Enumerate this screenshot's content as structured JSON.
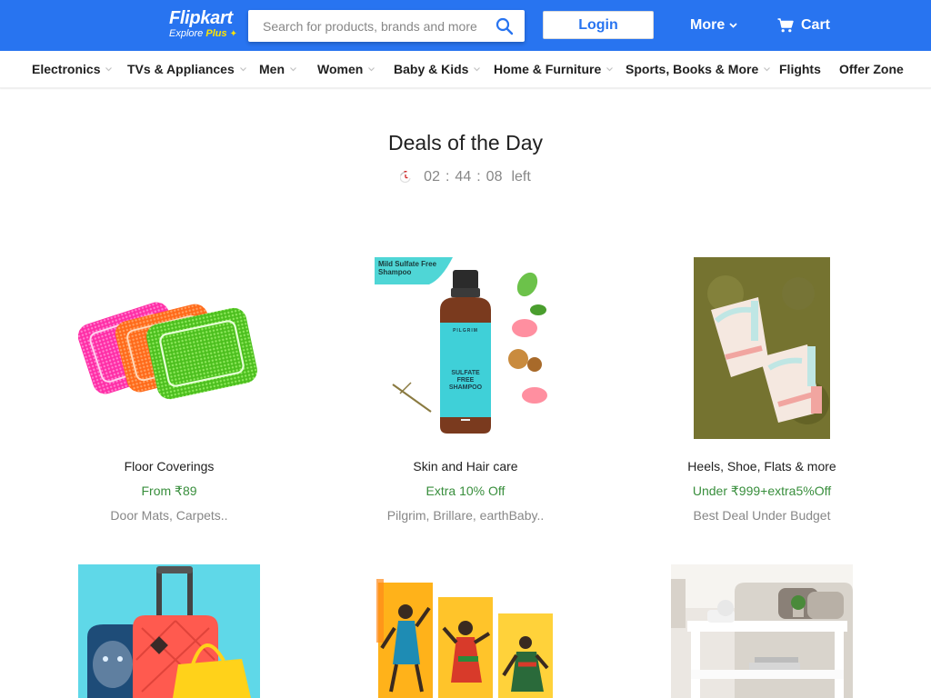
{
  "header": {
    "logo_text": "Flipkart",
    "logo_sub": "Explore",
    "logo_plus": "Plus",
    "search_placeholder": "Search for products, brands and more",
    "login_label": "Login",
    "more_label": "More",
    "cart_label": "Cart",
    "brand_color": "#2874f0"
  },
  "nav": {
    "items": [
      {
        "label": "Electronics",
        "has_caret": true
      },
      {
        "label": "TVs & Appliances",
        "has_caret": true
      },
      {
        "label": "Men",
        "has_caret": true
      },
      {
        "label": "Women",
        "has_caret": true
      },
      {
        "label": "Baby & Kids",
        "has_caret": true
      },
      {
        "label": "Home & Furniture",
        "has_caret": true
      },
      {
        "label": "Sports, Books & More",
        "has_caret": true
      },
      {
        "label": "Flights",
        "has_caret": false
      },
      {
        "label": "Offer Zone",
        "has_caret": false
      }
    ]
  },
  "deals": {
    "title": "Deals of the Day",
    "timer_hours": "02",
    "timer_minutes": "44",
    "timer_seconds": "08",
    "timer_suffix": "left",
    "separator": ":"
  },
  "products": [
    {
      "name": "Floor Coverings",
      "offer": "From ₹89",
      "sub": "Door Mats, Carpets..",
      "image": "floor-mats-image"
    },
    {
      "name": "Skin and Hair care",
      "offer": "Extra 10% Off",
      "sub": "Pilgrim, Brillare, earthBaby..",
      "image": "shampoo-bottle-image",
      "badge": "Mild Sulfate Free Shampoo",
      "bottle_brand": "PILGRIM",
      "bottle_label": "SULFATE FREE SHAMPOO"
    },
    {
      "name": "Heels, Shoe, Flats & more",
      "offer": "Under ₹999+extra5%Off",
      "sub": "Best Deal Under Budget",
      "image": "heel-sandals-image"
    },
    {
      "name": "",
      "offer": "",
      "sub": "",
      "image": "luggage-bags-image"
    },
    {
      "name": "",
      "offer": "",
      "sub": "",
      "image": "tribal-art-paintings-image"
    },
    {
      "name": "",
      "offer": "",
      "sub": "",
      "image": "white-side-table-image"
    }
  ],
  "colors": {
    "offer_green": "#388e3c",
    "muted_grey": "#878787",
    "accent_yellow": "#ffe500"
  }
}
